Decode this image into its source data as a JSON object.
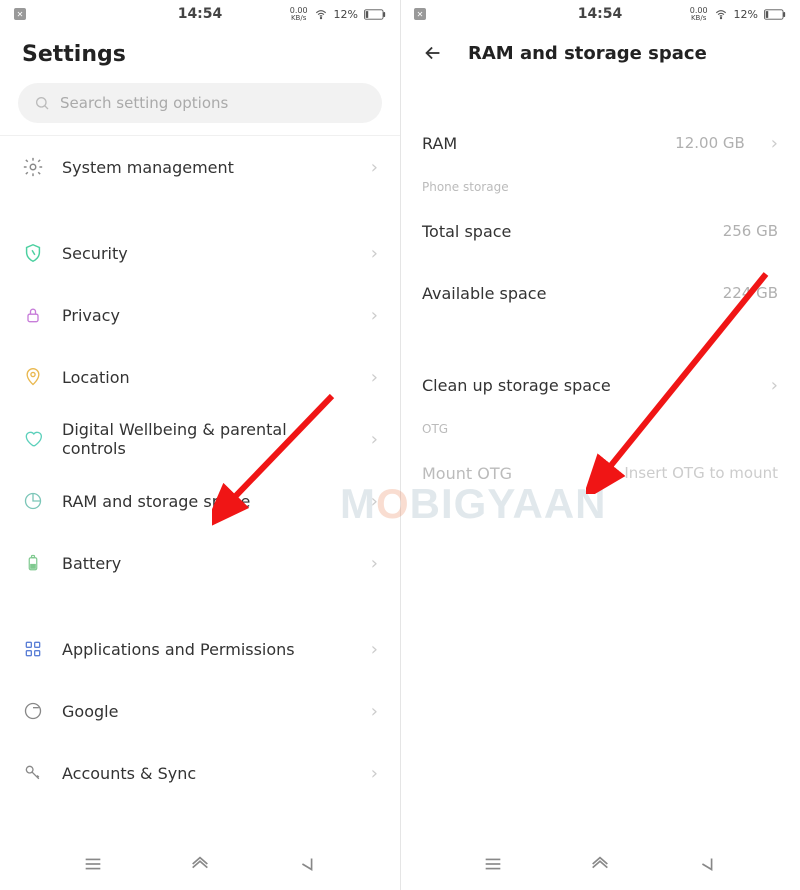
{
  "statusbar": {
    "time": "14:54",
    "speed_top": "0.00",
    "speed_bottom": "KB/s",
    "battery_pct": "12%"
  },
  "leftScreen": {
    "title": "Settings",
    "search_placeholder": "Search setting options",
    "group1": {
      "system": "System management"
    },
    "group2": {
      "security": "Security",
      "privacy": "Privacy",
      "location": "Location",
      "wellbeing": "Digital Wellbeing & parental controls",
      "ram": "RAM and storage space",
      "battery": "Battery"
    },
    "group3": {
      "apps": "Applications and Permissions",
      "google": "Google",
      "accounts": "Accounts & Sync"
    }
  },
  "rightScreen": {
    "title": "RAM and storage space",
    "rows": {
      "ram_label": "RAM",
      "ram_value": "12.00 GB",
      "section_storage": "Phone storage",
      "total_label": "Total space",
      "total_value": "256 GB",
      "avail_label": "Available space",
      "avail_value": "224 GB",
      "clean_label": "Clean up storage space",
      "section_otg": "OTG",
      "mount_label": "Mount OTG",
      "mount_value": "Insert OTG to mount"
    }
  },
  "watermark": {
    "pre": "M",
    "o": "O",
    "post": "BIGYAAN"
  }
}
